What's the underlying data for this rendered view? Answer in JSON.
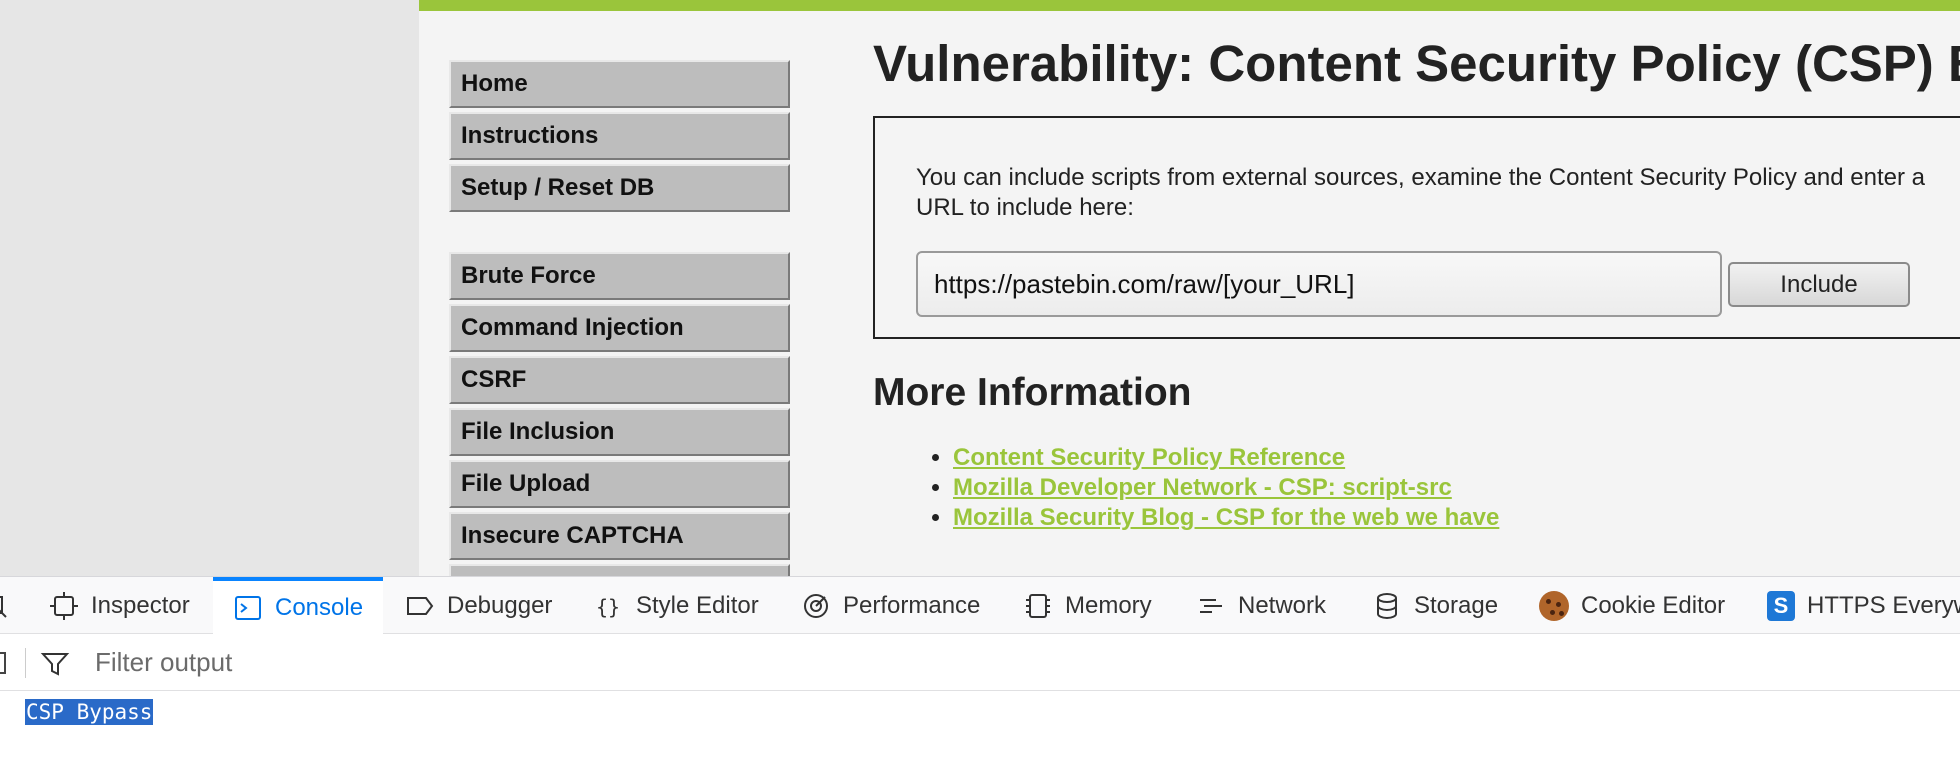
{
  "menu": {
    "group1": [
      "Home",
      "Instructions",
      "Setup / Reset DB"
    ],
    "group2": [
      "Brute Force",
      "Command Injection",
      "CSRF",
      "File Inclusion",
      "File Upload",
      "Insecure CAPTCHA"
    ]
  },
  "main": {
    "title": "Vulnerability: Content Security Policy (CSP) Bypass",
    "description": "You can include scripts from external sources, examine the Content Security Policy and enter a URL to include here:",
    "url_value": "https://pastebin.com/raw/[your_URL]",
    "include_label": "Include",
    "more_info_title": "More Information",
    "links": [
      "Content Security Policy Reference",
      "Mozilla Developer Network - CSP: script-src",
      "Mozilla Security Blog - CSP for the web we have"
    ]
  },
  "devtools": {
    "tabs": [
      {
        "label": "Inspector",
        "icon": "inspector-icon"
      },
      {
        "label": "Console",
        "icon": "console-icon",
        "active": true
      },
      {
        "label": "Debugger",
        "icon": "debugger-icon"
      },
      {
        "label": "Style Editor",
        "icon": "style-editor-icon"
      },
      {
        "label": "Performance",
        "icon": "performance-icon"
      },
      {
        "label": "Memory",
        "icon": "memory-icon"
      },
      {
        "label": "Network",
        "icon": "network-icon"
      },
      {
        "label": "Storage",
        "icon": "storage-icon"
      },
      {
        "label": "Cookie Editor",
        "icon": "cookie-icon"
      },
      {
        "label": "HTTPS Everywhere",
        "icon": "https-everywhere-icon"
      }
    ],
    "filter_placeholder": "Filter output",
    "console_output": "CSP Bypass"
  },
  "colors": {
    "accent_green": "#9ac53b",
    "devtools_active_blue": "#0a84ff",
    "selection_blue": "#2a6ac8"
  }
}
